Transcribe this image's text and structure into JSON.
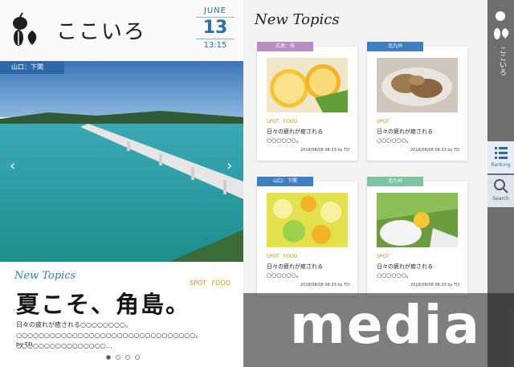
{
  "brand": {
    "name": "ここいろ"
  },
  "date": {
    "month": "JUNE",
    "day": "13",
    "time": "13:15"
  },
  "hero": {
    "location_tag": "山口：下関"
  },
  "featured": {
    "section_label": "New Topics",
    "spot": "SPOT",
    "food": "FOOD",
    "title": "夏こそ、角島。",
    "excerpt": "日々の疲れが癒される○○○○○○○○。○○○○○○○○○○○○○○○○○○○○○○○○○○○○○○○○。○○○○○○○○○○○○○○○○…",
    "author": "by TD",
    "page_count": 4,
    "active_page": 1
  },
  "topics": {
    "heading": "New Topics",
    "cards": [
      {
        "region": "広島：呉",
        "region_color": "#b78ec3",
        "spot": "SPOT",
        "food": "FOOD",
        "text": "日々の疲れが癒される○○○○○○。",
        "meta": "2018/08/08 08:33  by TD"
      },
      {
        "region": "北九州",
        "region_color": "#3f7fbf",
        "spot": "SPOT",
        "food": "",
        "text": "日々の疲れが癒される○○○○○○。",
        "meta": "2018/08/08 08:33  by TD"
      },
      {
        "region": "山口：下関",
        "region_color": "#3f7fbf",
        "spot": "SPOT",
        "food": "FOOD",
        "text": "日々の疲れが癒される○○○○○○。",
        "meta": "2018/08/08 08:33  by TD"
      },
      {
        "region": "北九州",
        "region_color": "#7bc4a2",
        "spot": "SPOT",
        "food": "",
        "text": "日々の疲れが癒される○○○○○○。",
        "meta": "2018/08/08 08:33  by TD"
      }
    ]
  },
  "sidebar": {
    "brand": "ここいろ",
    "ranking_label": "Ranking",
    "search_label": "Search"
  },
  "banner": {
    "text": "media"
  }
}
